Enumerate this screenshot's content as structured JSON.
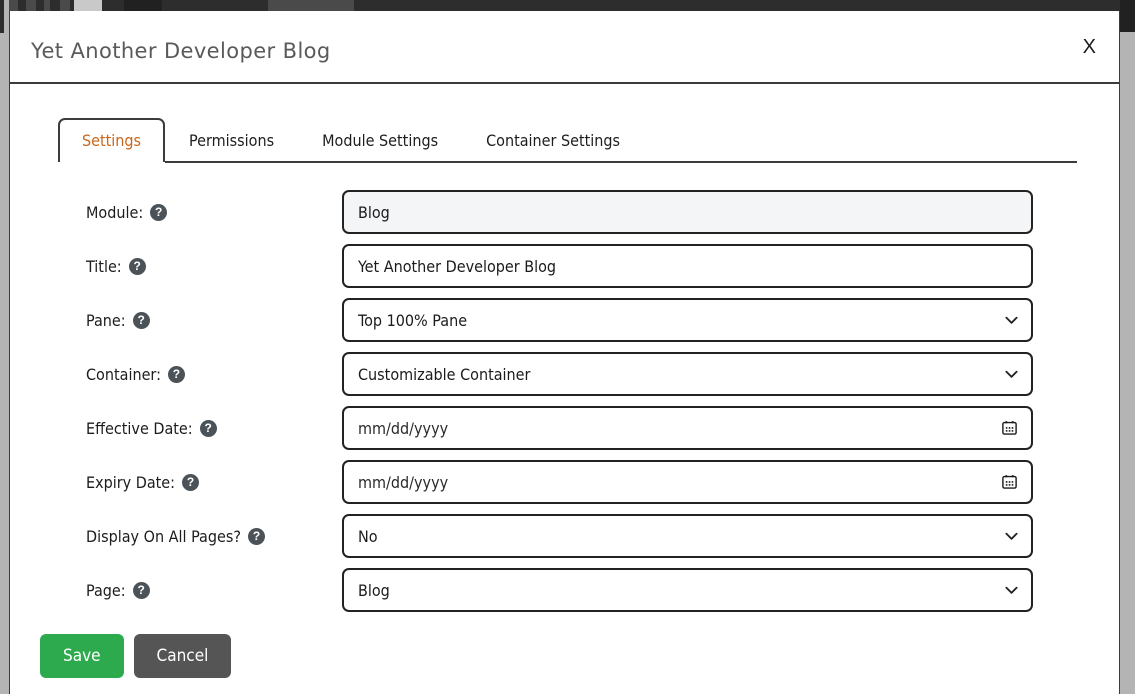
{
  "window": {
    "accent_orange": "#c9661a",
    "save_color": "#2eaa4e",
    "cancel_color": "#555555"
  },
  "modal": {
    "title": "Yet Another Developer Blog",
    "close_label": "X"
  },
  "tabs": [
    {
      "label": "Settings",
      "active": true
    },
    {
      "label": "Permissions",
      "active": false
    },
    {
      "label": "Module Settings",
      "active": false
    },
    {
      "label": "Container Settings",
      "active": false
    }
  ],
  "help_glyph": "?",
  "form": {
    "rows": [
      {
        "label": "Module:",
        "type": "text",
        "readonly": true,
        "value": "Blog",
        "placeholder": ""
      },
      {
        "label": "Title:",
        "type": "text",
        "readonly": false,
        "value": "Yet Another Developer Blog",
        "placeholder": ""
      },
      {
        "label": "Pane:",
        "type": "select",
        "readonly": false,
        "value": "Top 100% Pane",
        "placeholder": ""
      },
      {
        "label": "Container:",
        "type": "select",
        "readonly": false,
        "value": "Customizable Container",
        "placeholder": ""
      },
      {
        "label": "Effective Date:",
        "type": "date",
        "readonly": false,
        "value": "",
        "placeholder": "mm/dd/yyyy"
      },
      {
        "label": "Expiry Date:",
        "type": "date",
        "readonly": false,
        "value": "",
        "placeholder": "mm/dd/yyyy"
      },
      {
        "label": "Display On All Pages?",
        "type": "select",
        "readonly": false,
        "value": "No",
        "placeholder": ""
      },
      {
        "label": "Page:",
        "type": "select",
        "readonly": false,
        "value": "Blog",
        "placeholder": ""
      }
    ]
  },
  "footer": {
    "save_label": "Save",
    "cancel_label": "Cancel"
  }
}
